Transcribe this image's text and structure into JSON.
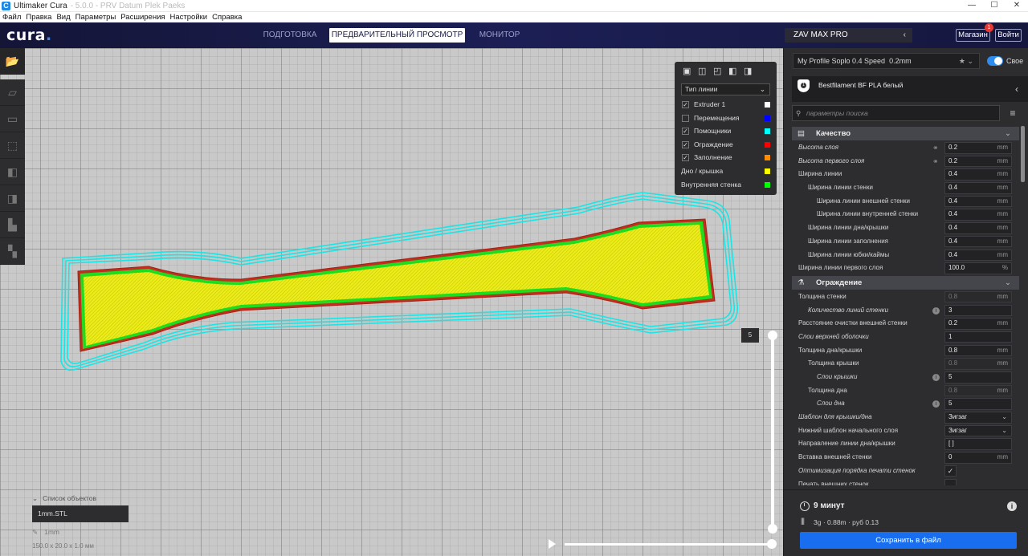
{
  "window": {
    "title": "Ultimaker Cura",
    "title_extra": "- 5.0.0 - PRV Datum Plek Paeks",
    "controls": [
      "—",
      "☐",
      "✕"
    ]
  },
  "menu": [
    "Файл",
    "Правка",
    "Вид",
    "Параметры",
    "Расширения",
    "Настройки",
    "Справка"
  ],
  "header": {
    "logo": "cura",
    "logo_dot": ".",
    "tabs": [
      "ПОДГОТОВКА",
      "ПРЕДВАРИТЕЛЬНЫЙ ПРОСМОТР",
      "МОНИТОР"
    ],
    "active_tab": 1,
    "printer": "ZAV MAX PRO",
    "shop_label": "Магазин",
    "shop_badge": "1",
    "login_label": "Войти"
  },
  "viewport": {
    "tools": [
      "open-file",
      "view-3d",
      "view-front",
      "view-top",
      "view-left",
      "view-right",
      "layer-view",
      "x-ray"
    ],
    "legend": {
      "line_type": "Тип линии",
      "rows": [
        {
          "label": "Extruder 1",
          "checked": true,
          "color": "#ffffff"
        },
        {
          "label": "Перемещения",
          "checked": false,
          "color": "#0000ff"
        },
        {
          "label": "Помощники",
          "checked": true,
          "color": "#00ffff"
        },
        {
          "label": "Ограждение",
          "checked": true,
          "color": "#ff0000"
        },
        {
          "label": "Заполнение",
          "checked": true,
          "color": "#ff8c00"
        },
        {
          "label": "Дно / крышка",
          "checked": null,
          "color": "#ffff00"
        },
        {
          "label": "Внутренняя стенка",
          "checked": null,
          "color": "#00ff00"
        }
      ]
    },
    "layer_number": "5",
    "object_list_label": "Список объектов",
    "object_file": "1mm.STL",
    "object_name": "1mm",
    "object_dims": "150.0 x 20.0 x 1.0 мм"
  },
  "panel": {
    "profile": "My Profile Soplo 0.4 Speed",
    "layer_height": "0.2mm",
    "custom_label": "Свое",
    "material": "Bestfilament BF PLA белый",
    "search_placeholder": "параметры поиска",
    "categories": [
      {
        "title": "Качество",
        "icon": "quality-icon",
        "rows": [
          {
            "label": "Высота слоя",
            "indent": 0,
            "italic": true,
            "value": "0.2",
            "unit": "mm",
            "link": true
          },
          {
            "label": "Высота первого слоя",
            "indent": 0,
            "italic": true,
            "value": "0.2",
            "unit": "mm",
            "link": true
          },
          {
            "label": "Ширина линии",
            "indent": 0,
            "value": "0.4",
            "unit": "mm"
          },
          {
            "label": "Ширина линии стенки",
            "indent": 1,
            "value": "0.4",
            "unit": "mm"
          },
          {
            "label": "Ширина линии внешней стенки",
            "indent": 2,
            "value": "0.4",
            "unit": "mm"
          },
          {
            "label": "Ширина линии внутренней стенки",
            "indent": 2,
            "value": "0.4",
            "unit": "mm"
          },
          {
            "label": "Ширина линии дна/крышки",
            "indent": 1,
            "value": "0.4",
            "unit": "mm"
          },
          {
            "label": "Ширина линии заполнения",
            "indent": 1,
            "value": "0.4",
            "unit": "mm"
          },
          {
            "label": "Ширина линии юбки/каймы",
            "indent": 1,
            "value": "0.4",
            "unit": "mm"
          },
          {
            "label": "Ширина линии первого слоя",
            "indent": 0,
            "value": "100.0",
            "unit": "%"
          }
        ]
      },
      {
        "title": "Ограждение",
        "icon": "shell-icon",
        "rows": [
          {
            "label": "Толщина стенки",
            "indent": 0,
            "value": "0.8",
            "unit": "mm",
            "dim": true
          },
          {
            "label": "Количество линий стенки",
            "indent": 1,
            "italic": true,
            "value": "3",
            "info": true
          },
          {
            "label": "Расстояние очистки внешней стенки",
            "indent": 0,
            "value": "0.2",
            "unit": "mm"
          },
          {
            "label": "Слои верхней оболочки",
            "indent": 0,
            "italic": true,
            "value": "1"
          },
          {
            "label": "Толщина дна/крышки",
            "indent": 0,
            "value": "0.8",
            "unit": "mm"
          },
          {
            "label": "Толщина крышки",
            "indent": 1,
            "value": "0.8",
            "unit": "mm",
            "dim": true
          },
          {
            "label": "Слои крышки",
            "indent": 2,
            "italic": true,
            "value": "5",
            "info": true
          },
          {
            "label": "Толщина дна",
            "indent": 1,
            "value": "0.8",
            "unit": "mm",
            "dim": true
          },
          {
            "label": "Слои дна",
            "indent": 2,
            "italic": true,
            "value": "5",
            "info": true
          },
          {
            "label": "Шаблон для крышки/дна",
            "indent": 0,
            "italic": true,
            "value": "Зигзаг",
            "select": true
          },
          {
            "label": "Нижний шаблон начального слоя",
            "indent": 0,
            "value": "Зигзаг",
            "select": true
          },
          {
            "label": "Направление линии дна/крышки",
            "indent": 0,
            "value": "[ ]"
          },
          {
            "label": "Вставка внешней стенки",
            "indent": 0,
            "value": "0",
            "unit": "mm"
          },
          {
            "label": "Оптимизация порядка печати стенок",
            "indent": 0,
            "italic": true,
            "check": true,
            "checked": true
          },
          {
            "label": "Печать внешних стенок",
            "indent": 0,
            "check": true,
            "checked": false
          }
        ]
      }
    ],
    "print_time": "9 минут",
    "filament": "3g · 0.88m · руб 0.13",
    "save_label": "Сохранить в файл"
  }
}
